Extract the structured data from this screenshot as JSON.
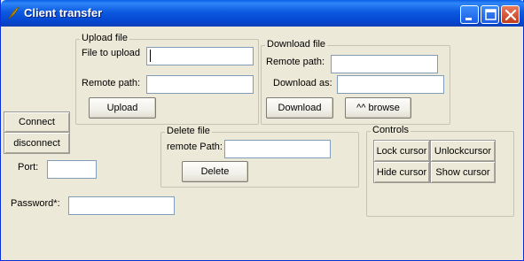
{
  "window": {
    "title": "Client transfer"
  },
  "upload": {
    "legend": "Upload file",
    "file_label": "File to upload",
    "file_value": "",
    "remote_label": "Remote path:",
    "remote_value": "",
    "button": "Upload"
  },
  "download": {
    "legend": "Download file",
    "remote_label": "Remote path:",
    "remote_value": "",
    "as_label": "Download as:",
    "as_value": "",
    "button": "Download",
    "browse": "^^ browse"
  },
  "connection": {
    "connect": "Connect",
    "disconnect": "disconnect",
    "port_label": "Port:",
    "port_value": "",
    "password_label": "Password*:",
    "password_value": ""
  },
  "delete": {
    "legend": "Delete file",
    "remote_label": "remote Path:",
    "remote_value": "",
    "button": "Delete"
  },
  "controls": {
    "legend": "Controls",
    "lock": "Lock cursor",
    "unlock": "Unlockcursor",
    "hide": "Hide cursor",
    "show": "Show cursor"
  },
  "icons": {
    "app": "tk-feather-icon",
    "minimize": "minimize-icon",
    "maximize": "maximize-icon",
    "close": "close-icon"
  },
  "colors": {
    "titlebar": "#0a5fe8",
    "window_bg": "#ece9d8",
    "close_button": "#c13d1c"
  }
}
